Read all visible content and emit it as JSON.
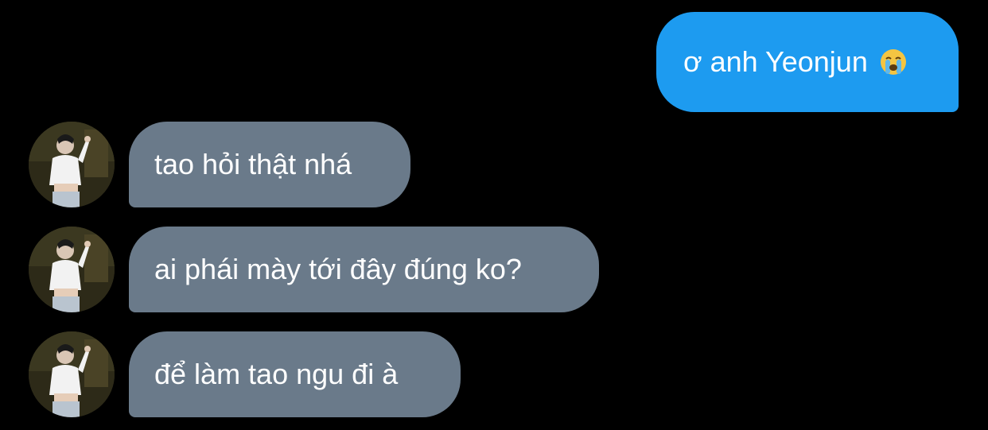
{
  "conversation": {
    "messages": [
      {
        "direction": "sent",
        "text": "ơ anh Yeonjun",
        "emoji": "loudly-crying-face-icon"
      },
      {
        "direction": "received",
        "text": "tao hỏi thật nhá"
      },
      {
        "direction": "received",
        "text": "ai phái mày tới đây đúng ko?"
      },
      {
        "direction": "received",
        "text": "để làm tao ngu đi à"
      }
    ]
  },
  "colors": {
    "background": "#000000",
    "sent_bubble": "#1d9bf0",
    "received_bubble": "#6a7a8a",
    "text": "#ffffff"
  }
}
